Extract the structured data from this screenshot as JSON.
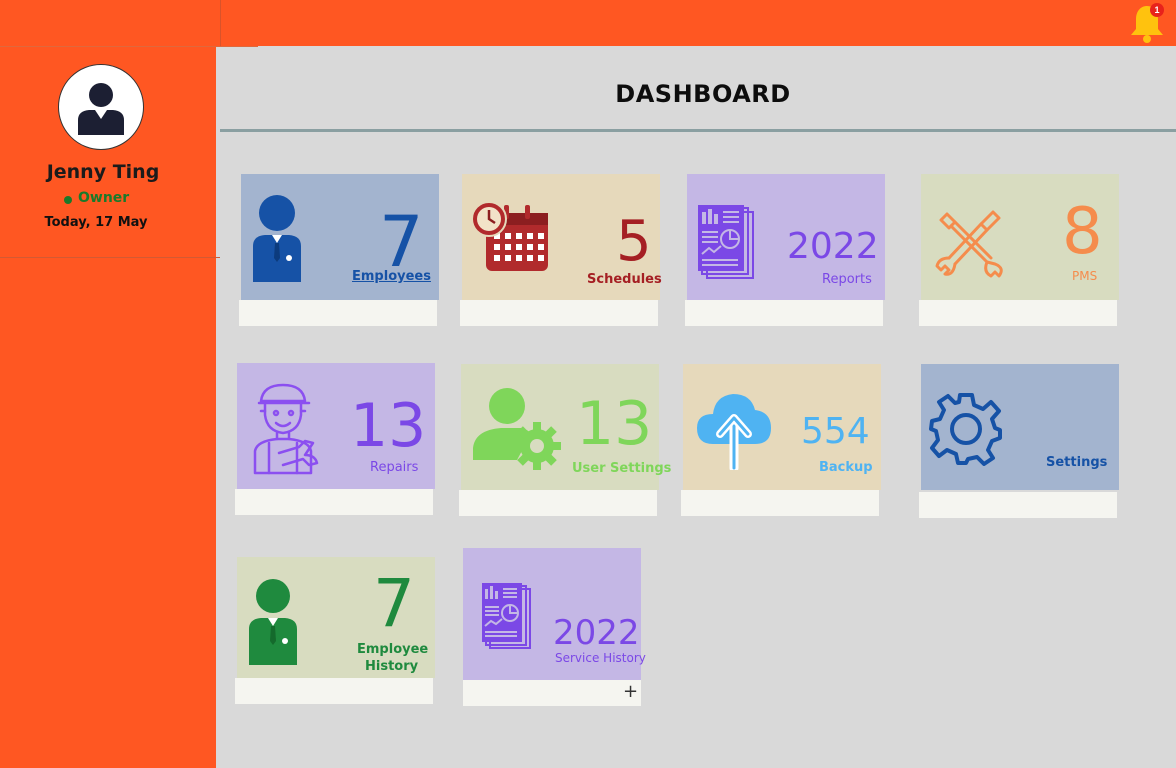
{
  "header": {
    "notification_count": "1"
  },
  "profile": {
    "name": "Jenny Ting",
    "role": "Owner",
    "date": "Today, 17 May"
  },
  "page": {
    "title": "DASHBOARD"
  },
  "cards": {
    "employees": {
      "value": "7",
      "label": "Employees"
    },
    "schedules": {
      "value": "5",
      "label": "Schedules"
    },
    "reports": {
      "value": "2022",
      "label": "Reports"
    },
    "pms": {
      "value": "8",
      "label": "PMS"
    },
    "repairs": {
      "value": "13",
      "label": "Repairs"
    },
    "user_settings": {
      "value": "13",
      "label": "User Settings"
    },
    "backup": {
      "value": "554",
      "label": "Backup"
    },
    "settings": {
      "label": "Settings"
    },
    "employee_history": {
      "value": "7",
      "label_line1": "Employee",
      "label_line2": "History"
    },
    "service_history": {
      "value": "2022",
      "label": "Service History",
      "add_symbol": "+"
    }
  },
  "colors": {
    "accent": "#ff5722",
    "blue_card": "#a3b4cf",
    "tan_card": "#e6d9bb",
    "purple_card": "#c4b7e5",
    "green_card": "#d8dcc0"
  }
}
